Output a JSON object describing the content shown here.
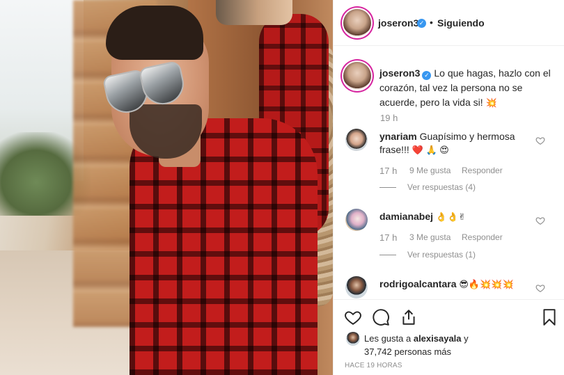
{
  "post": {
    "header": {
      "username": "joseron3",
      "separator": "•",
      "follow_status": "Siguiendo"
    },
    "caption": {
      "username": "joseron3",
      "text": "Lo que hagas, hazlo con el corazón, tal vez la persona no se acuerde, pero la vida si!",
      "emoji": "💥",
      "time": "19 h"
    },
    "comments": [
      {
        "username": "ynariam",
        "text": "Guapísimo y hermosa frase!!!",
        "emojis": "❤️ 🙏 😍",
        "time": "17 h",
        "likes": "9 Me gusta",
        "reply_label": "Responder",
        "view_replies": "Ver respuestas (4)"
      },
      {
        "username": "damianabej",
        "text": "",
        "emojis": "👌👌✌",
        "time": "17 h",
        "likes": "3 Me gusta",
        "reply_label": "Responder",
        "view_replies": "Ver respuestas (1)"
      },
      {
        "username": "rodrigoalcantara",
        "text": "",
        "emojis": "😎🔥💥💥💥"
      }
    ],
    "actions": {
      "like_icon": "heart-icon",
      "comment_icon": "comment-icon",
      "share_icon": "share-icon",
      "save_icon": "bookmark-icon"
    },
    "likes_summary": {
      "prefix": "Les gusta a",
      "user": "alexisayala",
      "conj": "y",
      "others": "37,742 personas más"
    },
    "timestamp": "HACE 19 HORAS"
  },
  "colors": {
    "verified": "#3897f0",
    "muted": "#8e8e8e",
    "text": "#262626",
    "heart_red": "#ed4956"
  }
}
